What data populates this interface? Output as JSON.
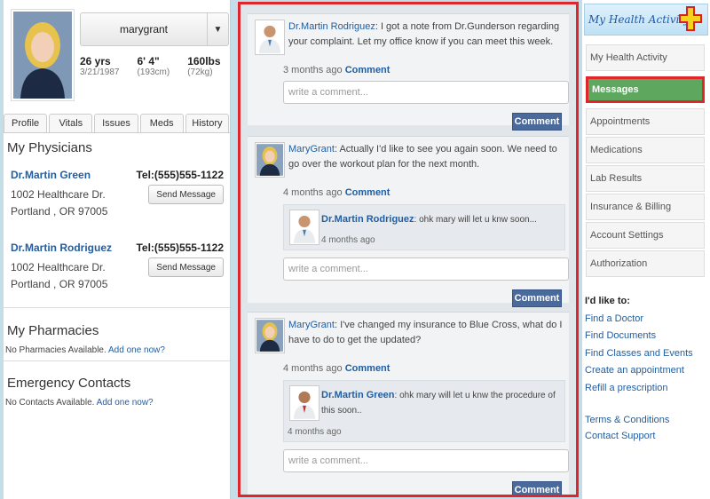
{
  "profile": {
    "username": "marygrant",
    "stats": [
      {
        "big": "26 yrs",
        "small": "3/21/1987"
      },
      {
        "big": "6' 4\"",
        "small": "(193cm)"
      },
      {
        "big": "160lbs",
        "small": "(72kg)"
      }
    ]
  },
  "tabs": [
    "Profile",
    "Vitals",
    "Issues",
    "Meds",
    "History"
  ],
  "physicians": {
    "title": "My Physicians",
    "items": [
      {
        "name": "Dr.Martin Green",
        "tel": "Tel:(555)555-1122",
        "addr1": "1002 Healthcare Dr.",
        "addr2": "Portland , OR 97005",
        "button": "Send Message"
      },
      {
        "name": "Dr.Martin Rodriguez",
        "tel": "Tel:(555)555-1122",
        "addr1": "1002 Healthcare Dr.",
        "addr2": "Portland , OR 97005",
        "button": "Send Message"
      }
    ]
  },
  "pharmacies": {
    "title": "My Pharmacies",
    "text": "No Pharmacies Available.",
    "link": "Add one now?"
  },
  "emergency": {
    "title": "Emergency Contacts",
    "text": "No Contacts Available.",
    "link": "Add one now?"
  },
  "messages": [
    {
      "author": "Dr.Martin Rodriguez",
      "text": ": I got a note from Dr.Gunderson regarding your complaint. Let my office know if you can meet this week.",
      "time": "3 months ago",
      "comment": "Comment"
    },
    {
      "author": "MaryGrant",
      "text": ": Actually I'd like to see you again soon. We need to go over the workout plan for the next month.",
      "time": "4 months ago",
      "comment": "Comment",
      "reply": {
        "author": "Dr.Martin Rodriguez",
        "text": ": ohk mary will let u knw soon...",
        "time": "4 months ago"
      }
    },
    {
      "author": "MaryGrant",
      "text": ": I've changed my insurance to Blue Cross, what do I have to do to get the updated?",
      "time": "4 months ago",
      "comment": "Comment",
      "reply": {
        "author": "Dr.Martin Green",
        "text": ": ohk mary will let u knw the procedure of this soon..",
        "time": "4 months ago"
      }
    }
  ],
  "comment_placeholder": "write a comment...",
  "comment_button": "Comment",
  "logo_text": "My Health Activity",
  "nav": [
    "My Health Activity",
    "Messages",
    "Appointments",
    "Medications",
    "Lab Results",
    "Insurance & Billing",
    "Account Settings",
    "Authorization"
  ],
  "like": {
    "heading": "I'd like to:",
    "links": [
      "Find a Doctor",
      "Find Documents",
      "Find Classes and Events",
      "Create an appointment",
      "Refill a prescription"
    ]
  },
  "footer_links": [
    "Terms & Conditions",
    "Contact Support"
  ],
  "colors": {
    "accent": "#215ea0",
    "highlight": "#e0262b",
    "active_nav": "#5ea75e",
    "button": "#4a6a9c"
  }
}
